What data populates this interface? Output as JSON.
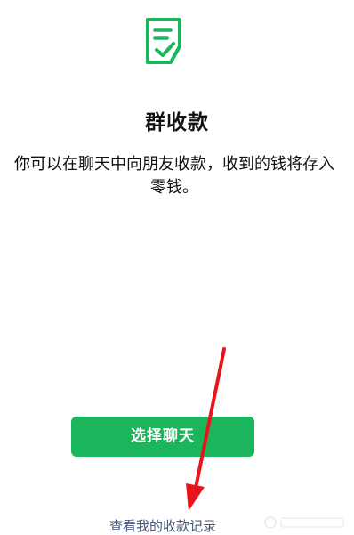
{
  "page": {
    "title": "群收款",
    "description": "你可以在聊天中向朋友收款，收到的钱将存入零钱。",
    "select_chat_button": "选择聊天",
    "records_link": "查看我的收款记录"
  },
  "icons": {
    "header_icon": "checklist-icon",
    "annotation": "red-arrow-annotation"
  },
  "colors": {
    "accent": "#1bb55c",
    "link": "#4a5578",
    "annotation": "#e8141c"
  }
}
